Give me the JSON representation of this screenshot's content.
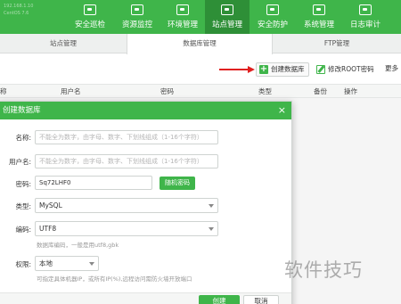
{
  "server_info": [
    "192.168.1.10",
    "CentOS 7.6"
  ],
  "nav": [
    {
      "label": "安全巡检",
      "icon": "shield-scan-icon"
    },
    {
      "label": "资源监控",
      "icon": "monitor-icon"
    },
    {
      "label": "环境管理",
      "icon": "env-icon"
    },
    {
      "label": "站点管理",
      "icon": "site-icon",
      "active": true
    },
    {
      "label": "安全防护",
      "icon": "protect-icon"
    },
    {
      "label": "系统管理",
      "icon": "system-icon"
    },
    {
      "label": "日志审计",
      "icon": "log-icon"
    }
  ],
  "subtabs": [
    "站点管理",
    "数据库管理",
    "FTP管理"
  ],
  "toolbar": {
    "create_db": "创建数据库",
    "modify_root": "修改ROOT密码",
    "more": "更多"
  },
  "table_headers": [
    "称",
    "用户名",
    "密码",
    "类型",
    "备份",
    "操作"
  ],
  "modal": {
    "title": "创建数据库",
    "close": "×",
    "name_label": "名称:",
    "name_placeholder": "不能全为数字，由字母、数字、下划线组成（1-16个字符）",
    "user_label": "用户名:",
    "user_placeholder": "不能全为数字，由字母、数字、下划线组成（1-16个字符）",
    "password_label": "密码:",
    "password_value": "Sq72LHF0",
    "random_password": "随机密码",
    "type_label": "类型:",
    "type_value": "MySQL",
    "encoding_label": "编码:",
    "encoding_value": "UTF8",
    "encoding_hint": "数据库编码，一般是用utf8,gbk",
    "access_label": "权限:",
    "access_value": "本地",
    "access_hint": "可指定具体机器IP，或所有IP(%),远程访问需防火墙开放端口",
    "ok": "创建",
    "cancel": "取消"
  },
  "watermark": "软件技巧",
  "colors": {
    "accent": "#3fb54a",
    "accent_dark": "#2e8f37",
    "arrow": "#e02020"
  }
}
